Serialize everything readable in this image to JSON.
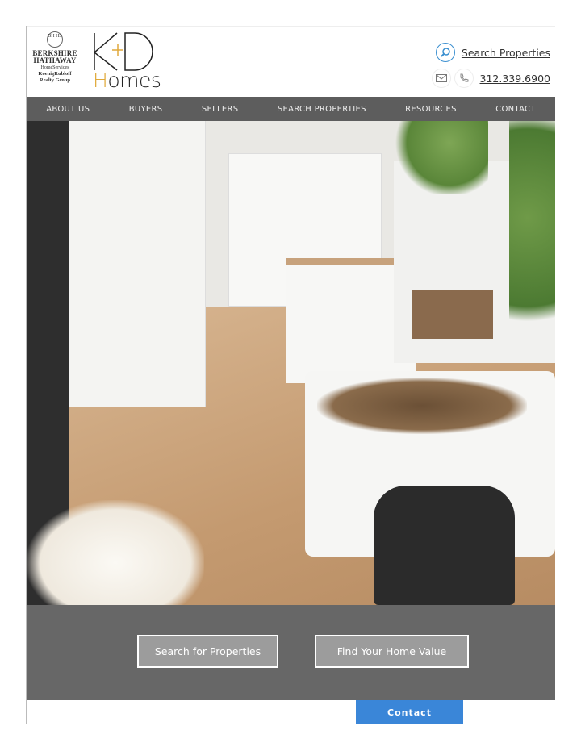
{
  "header": {
    "brokerage_logo": {
      "seal": "BH HS",
      "line1": "BERKSHIRE",
      "line2": "HATHAWAY",
      "line3": "HomeServices",
      "line4": "KoenigRubloff",
      "line5": "Realty Group"
    },
    "team_logo": {
      "mark": "K+D",
      "word_first": "H",
      "word_rest": "omes"
    },
    "search_link": "Search Properties",
    "phone": "312.339.6900",
    "accent_color": "#3a86d8"
  },
  "nav": {
    "items": [
      "ABOUT US",
      "BUYERS",
      "SELLERS",
      "SEARCH PROPERTIES",
      "RESOURCES",
      "CONTACT"
    ]
  },
  "hero": {
    "image": "kitchen-living-room-with-dog"
  },
  "cta": {
    "search": "Search for Properties",
    "home_value": "Find Your Home Value"
  },
  "contact_button": "Contact"
}
